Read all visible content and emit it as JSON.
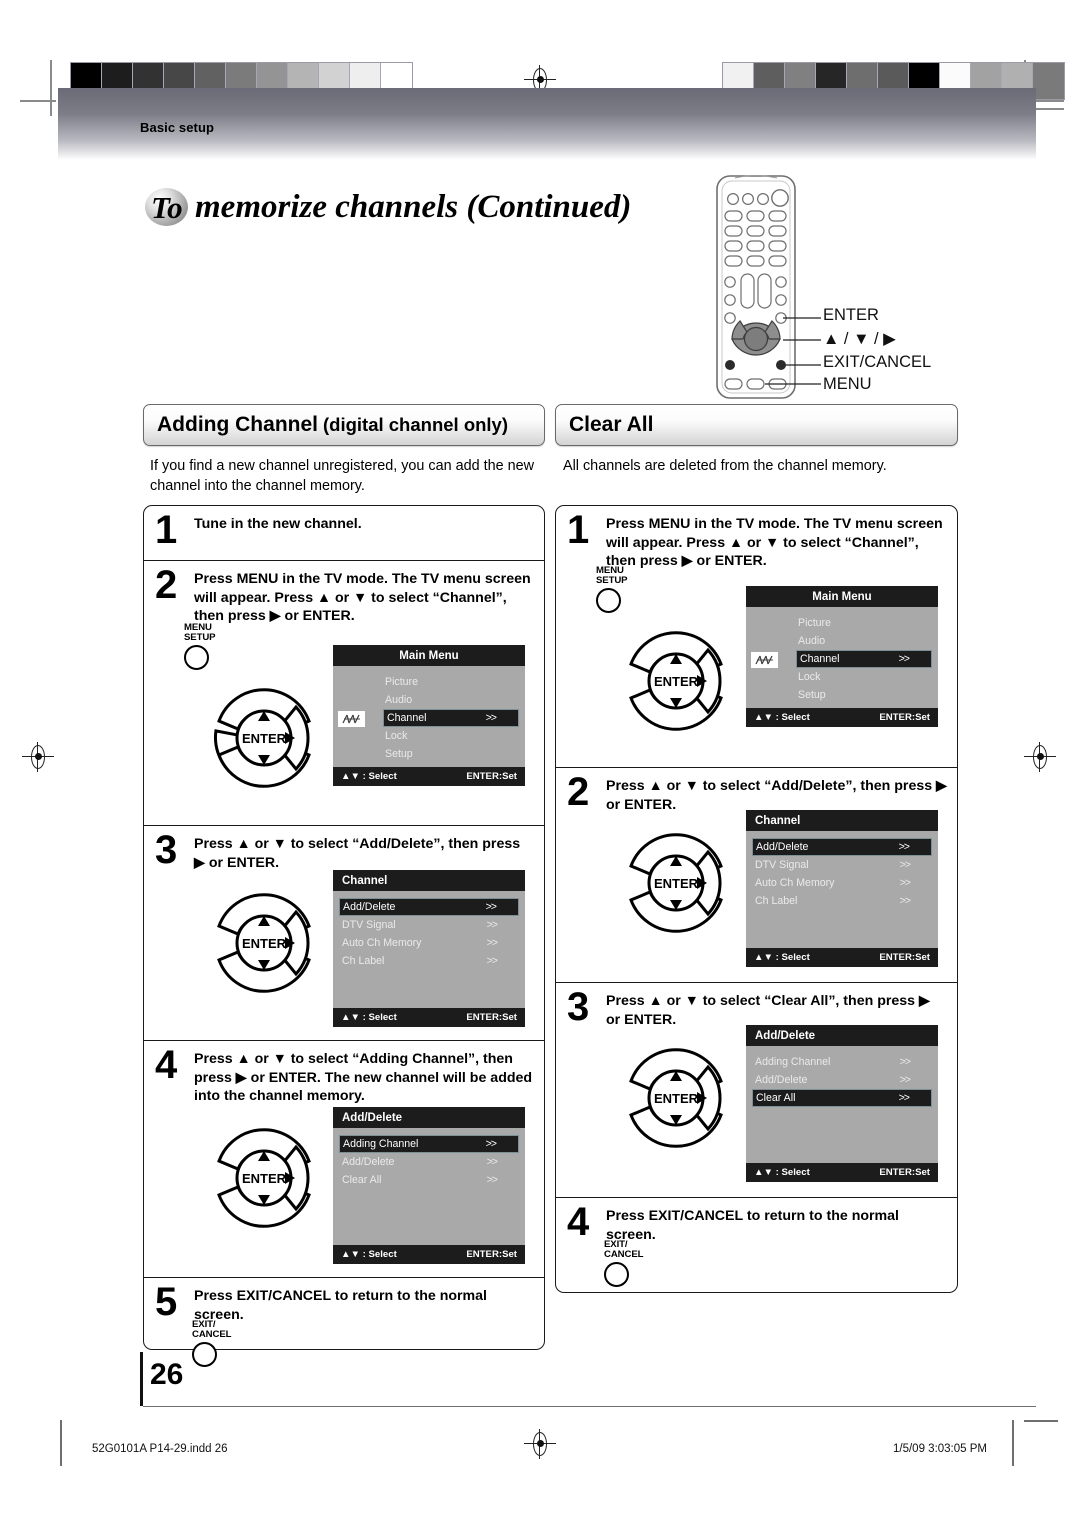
{
  "page": {
    "kicker": "Basic setup",
    "title_badge": "To",
    "title": "memorize channels (Continued)",
    "number": "26"
  },
  "remote_labels": [
    {
      "name": "enter",
      "text": "ENTER"
    },
    {
      "name": "dpad",
      "text": "▲ / ▼ / ▶"
    },
    {
      "name": "exit-cancel",
      "text": "EXIT/CANCEL"
    },
    {
      "name": "menu",
      "text": "MENU"
    }
  ],
  "columns": {
    "left": {
      "heading_main": "Adding Channel",
      "heading_sub": "(digital channel only)",
      "intro": "If you find a new channel unregistered, you can add the new channel into the channel memory.",
      "steps": [
        {
          "num": "1",
          "text": "Tune in the new channel."
        },
        {
          "num": "2",
          "text": "Press MENU in the TV mode. The TV menu screen will appear. Press ▲ or ▼ to select “Channel”, then press ▶ or ENTER."
        },
        {
          "num": "3",
          "text": "Press ▲ or ▼ to select “Add/Delete”, then press ▶ or ENTER."
        },
        {
          "num": "4",
          "text": "Press ▲ or ▼ to select “Adding Channel”, then press ▶ or ENTER. The new channel will be added into the channel memory."
        },
        {
          "num": "5",
          "text": "Press EXIT/CANCEL to return to the normal screen."
        }
      ]
    },
    "right": {
      "heading_main": "Clear All",
      "heading_sub": "",
      "intro": "All channels are deleted from the channel memory.",
      "steps": [
        {
          "num": "1",
          "text": "Press MENU in the TV mode. The TV menu screen will appear. Press ▲ or ▼ to select “Channel”, then press ▶ or ENTER."
        },
        {
          "num": "2",
          "text": "Press ▲ or ▼ to select “Add/Delete”, then press ▶ or ENTER."
        },
        {
          "num": "3",
          "text": "Press ▲ or ▼ to select “Clear All”, then press ▶ or ENTER."
        },
        {
          "num": "4",
          "text": "Press EXIT/CANCEL to return to the normal screen."
        }
      ]
    }
  },
  "buttons": {
    "menu_setup_line1": "MENU",
    "menu_setup_line2": "SETUP",
    "exit_cancel_line1": "EXIT/",
    "exit_cancel_line2": "CANCEL",
    "enter_label": "ENTER"
  },
  "osd": {
    "foot_select": "▲▼ : Select",
    "foot_set": "ENTER:Set",
    "arrow": ">>",
    "main_menu": {
      "title": "Main Menu",
      "rows": [
        {
          "label": "Picture",
          "arrow": "",
          "selected": false
        },
        {
          "label": "Audio",
          "arrow": "",
          "selected": false
        },
        {
          "label": "Channel",
          "arrow": ">>",
          "selected": true
        },
        {
          "label": "Lock",
          "arrow": "",
          "selected": false
        },
        {
          "label": "Setup",
          "arrow": "",
          "selected": false
        }
      ]
    },
    "channel": {
      "title": "Channel",
      "rows": [
        {
          "label": "Add/Delete",
          "arrow": ">>",
          "selected": true
        },
        {
          "label": "DTV Signal",
          "arrow": ">>",
          "selected": false
        },
        {
          "label": "Auto Ch Memory",
          "arrow": ">>",
          "selected": false
        },
        {
          "label": "Ch Label",
          "arrow": ">>",
          "selected": false
        }
      ]
    },
    "add_delete_adding": {
      "title": "Add/Delete",
      "rows": [
        {
          "label": "Adding Channel",
          "arrow": ">>",
          "selected": true
        },
        {
          "label": "Add/Delete",
          "arrow": ">>",
          "selected": false
        },
        {
          "label": "Clear All",
          "arrow": ">>",
          "selected": false
        }
      ]
    },
    "add_delete_clear": {
      "title": "Add/Delete",
      "rows": [
        {
          "label": "Adding Channel",
          "arrow": ">>",
          "selected": false
        },
        {
          "label": "Add/Delete",
          "arrow": ">>",
          "selected": false
        },
        {
          "label": "Clear All",
          "arrow": ">>",
          "selected": true
        }
      ]
    }
  },
  "footer": {
    "file": "52G0101A P14-29.indd   26",
    "date": "1/5/09   3:03:05 PM"
  },
  "colorbars": {
    "left": [
      "#000000",
      "#1d1d1d",
      "#323232",
      "#474747",
      "#616161",
      "#7b7b7b",
      "#949494",
      "#b4b4b4",
      "#d2d2d2",
      "#eeeeee",
      "#ffffff"
    ],
    "right": [
      "#f1f1f1",
      "#5e5e5e",
      "#808080",
      "#262626",
      "#6e6e6e",
      "#5a5a5a",
      "#000000",
      "#fbfbfb",
      "#a2a2a2",
      "#b0b0b0",
      "#7a7a7a"
    ]
  },
  "colors": {
    "osd_bg": "#a9a9a9",
    "osd_dark": "#1c1c1c",
    "band_dark": "#6c6c78"
  }
}
